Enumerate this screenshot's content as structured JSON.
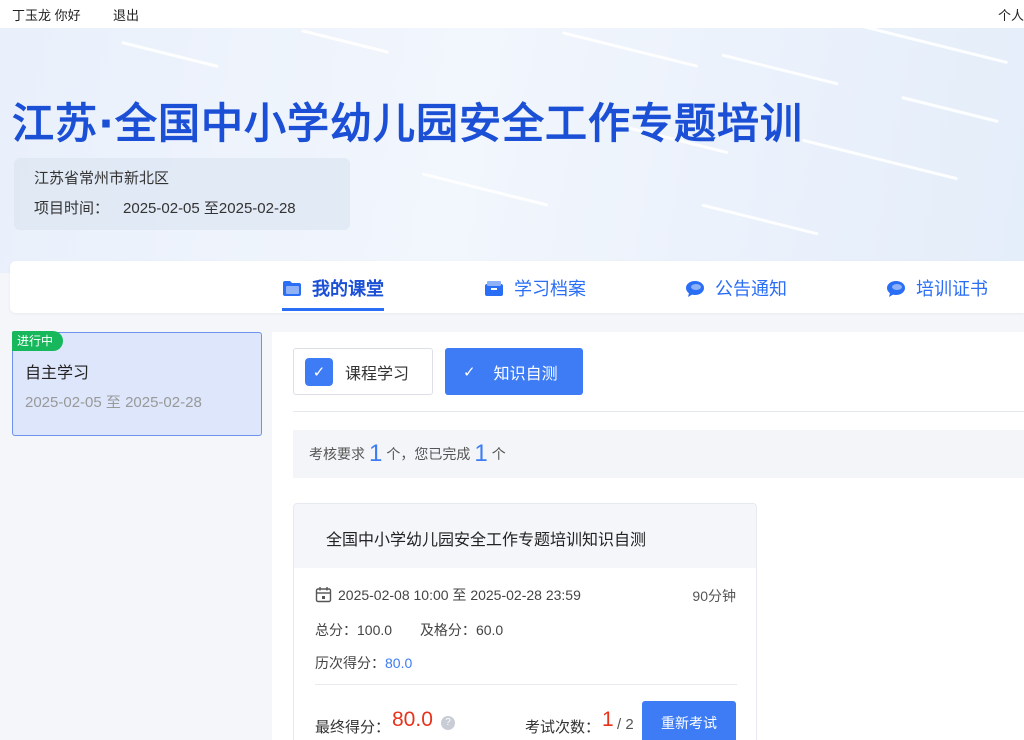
{
  "topbar": {
    "user_greeting": "丁玉龙 你好",
    "logout_label": "退出",
    "personal_label": "个人"
  },
  "banner": {
    "title": "江苏·全国中小学幼儿园安全工作专题培训",
    "region": "江苏省常州市新北区",
    "period_label": "项目时间：",
    "period_dates": "2025-02-05 至2025-02-28"
  },
  "nav": {
    "items": [
      {
        "label": "我的课堂",
        "icon": "folder-icon",
        "active": true
      },
      {
        "label": "学习档案",
        "icon": "archive-icon",
        "active": false
      },
      {
        "label": "公告通知",
        "icon": "chat-bubble-icon",
        "active": false
      },
      {
        "label": "培训证书",
        "icon": "chat-bubble-icon",
        "active": false
      }
    ]
  },
  "stage": {
    "badge": "进行中",
    "name": "自主学习",
    "range": "2025-02-05 至 2025-02-28"
  },
  "tabs": {
    "course": "课程学习",
    "selftest": "知识自测",
    "check_mark": "✓"
  },
  "requirement": {
    "prefix": "考核要求",
    "required": "1",
    "mid": "个，您已完成",
    "completed": "1",
    "suffix": "个"
  },
  "exam": {
    "title": "全国中小学幼儿园安全工作专题培训知识自测",
    "time_range": "2025-02-08 10:00 至 2025-02-28 23:59",
    "duration": "90分钟",
    "total_label": "总分：",
    "total_score": "100.0",
    "pass_label": "及格分：",
    "pass_score": "60.0",
    "history_label": "历次得分：",
    "history_score": "80.0",
    "final_label": "最终得分：",
    "final_score": "80.0",
    "help_glyph": "?",
    "tries_label": "考试次数：",
    "tries_used": "1",
    "tries_total": "/ 2",
    "retake_label": "重新考试"
  },
  "colors": {
    "accent": "#3d7cf5",
    "title_blue": "#1a4fd6",
    "badge_green": "#17b85b",
    "score_red": "#e8331c"
  }
}
